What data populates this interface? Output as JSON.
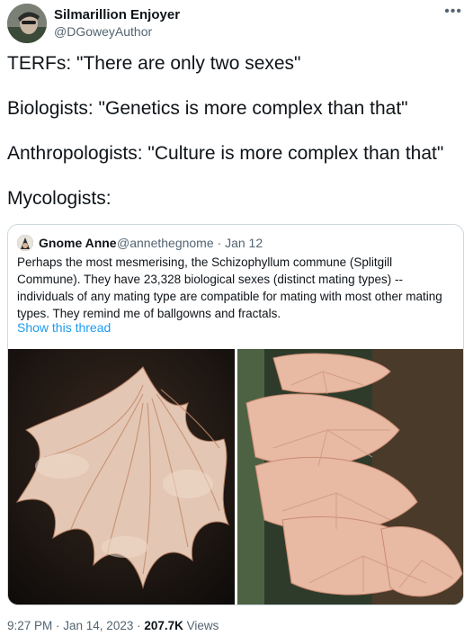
{
  "author": {
    "name": "Silmarillion Enjoyer",
    "handle": "@DGoweyAuthor"
  },
  "more_icon": "more-horizontal-icon",
  "tweet": {
    "lines": [
      "TERFs: \"There are only two sexes\"",
      "Biologists: \"Genetics is more complex than that\"",
      "Anthropologists: \"Culture is more complex than that\"",
      "Mycologists:"
    ]
  },
  "quote": {
    "name": "Gnome Anne",
    "meta": "@annethegnome · Jan 12",
    "text": "Perhaps the most mesmerising, the Schizophyllum commune (Splitgill Commune). They have 23,328 biological sexes (distinct mating types) -- individuals of any mating type are compatible for mating with most other mating types. They remind me of ballgowns and fractals.",
    "show_thread": "Show this thread"
  },
  "footer": {
    "time": "9:27 PM · Jan 14, 2023 · ",
    "views_count": "207.7K",
    "views_label": " Views"
  },
  "colors": {
    "text": "#0f1419",
    "secondary": "#536471",
    "link": "#1d9bf0",
    "border": "#cfd9de"
  }
}
